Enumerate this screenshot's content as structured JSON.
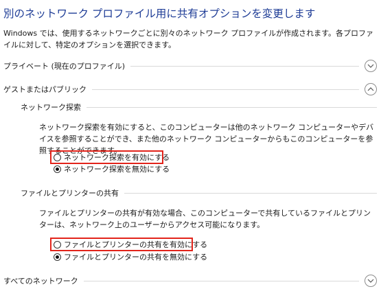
{
  "page": {
    "title": "別のネットワーク プロファイル用に共有オプションを変更します",
    "description": "Windows では、使用するネットワークごとに別々のネットワーク プロファイルが作成されます。各プロファイルに対して、特定のオプションを選択できます。"
  },
  "sections": {
    "private": {
      "label": "プライベート (現在のプロファイル)",
      "state": "collapsed"
    },
    "guest": {
      "label": "ゲストまたはパブリック",
      "state": "expanded",
      "network_discovery": {
        "heading": "ネットワーク探索",
        "description": "ネットワーク探索を有効にすると、このコンピューターは他のネットワーク コンピューターやデバイスを参照することができ、また他のネットワーク コンピューターからもこのコンピューターを参照することができます。",
        "option_on": "ネットワーク探索を有効にする",
        "option_off": "ネットワーク探索を無効にする",
        "selected": "off"
      },
      "file_sharing": {
        "heading": "ファイルとプリンターの共有",
        "description": "ファイルとプリンターの共有が有効な場合、このコンピューターで共有しているファイルとプリンターは、ネットワーク上のユーザーからアクセス可能になります。",
        "option_on": "ファイルとプリンターの共有を有効にする",
        "option_off": "ファイルとプリンターの共有を無効にする",
        "selected": "off"
      }
    },
    "all_networks": {
      "label": "すべてのネットワーク",
      "state": "collapsed"
    }
  },
  "colors": {
    "title": "#1e3c96",
    "highlight": "#e2231a",
    "rule": "#d9d9d9"
  },
  "icons": {
    "collapsed": "chevron-down-icon",
    "expanded": "chevron-up-icon"
  }
}
